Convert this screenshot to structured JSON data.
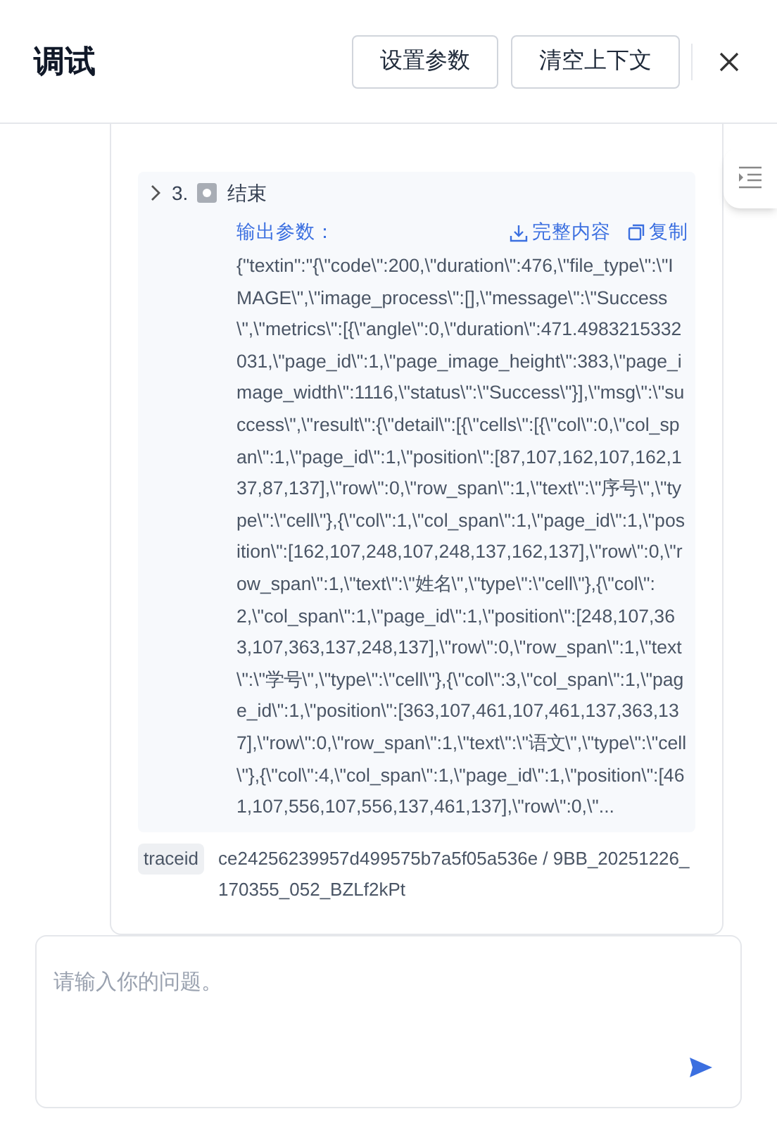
{
  "header": {
    "title": "调试",
    "buttons": [
      "设置参数",
      "清空上下文"
    ]
  },
  "step": {
    "number": "3.",
    "label": "结束"
  },
  "output": {
    "label": "输出参数：",
    "actions": [
      {
        "kind": "download",
        "label": "完整内容"
      },
      {
        "kind": "copy",
        "label": "复制"
      }
    ],
    "text": "{\"textin\":\"{\\\"code\\\":200,\\\"duration\\\":476,\\\"file_type\\\":\\\"IMAGE\\\",\\\"image_process\\\":[],\\\"message\\\":\\\"Success\\\",\\\"metrics\\\":[{\\\"angle\\\":0,\\\"duration\\\":471.4983215332031,\\\"page_id\\\":1,\\\"page_image_height\\\":383,\\\"page_image_width\\\":1116,\\\"status\\\":\\\"Success\\\"}],\\\"msg\\\":\\\"success\\\",\\\"result\\\":{\\\"detail\\\":[{\\\"cells\\\":[{\\\"col\\\":0,\\\"col_span\\\":1,\\\"page_id\\\":1,\\\"position\\\":[87,107,162,107,162,137,87,137],\\\"row\\\":0,\\\"row_span\\\":1,\\\"text\\\":\\\"序号\\\",\\\"type\\\":\\\"cell\\\"},{\\\"col\\\":1,\\\"col_span\\\":1,\\\"page_id\\\":1,\\\"position\\\":[162,107,248,107,248,137,162,137],\\\"row\\\":0,\\\"row_span\\\":1,\\\"text\\\":\\\"姓名\\\",\\\"type\\\":\\\"cell\\\"},{\\\"col\\\":2,\\\"col_span\\\":1,\\\"page_id\\\":1,\\\"position\\\":[248,107,363,107,363,137,248,137],\\\"row\\\":0,\\\"row_span\\\":1,\\\"text\\\":\\\"学号\\\",\\\"type\\\":\\\"cell\\\"},{\\\"col\\\":3,\\\"col_span\\\":1,\\\"page_id\\\":1,\\\"position\\\":[363,107,461,107,461,137,363,137],\\\"row\\\":0,\\\"row_span\\\":1,\\\"text\\\":\\\"语文\\\",\\\"type\\\":\\\"cell\\\"},{\\\"col\\\":4,\\\"col_span\\\":1,\\\"page_id\\\":1,\\\"position\\\":[461,107,556,107,556,137,461,137],\\\"row\\\":0,\\\"..."
  },
  "trace": {
    "tag": "traceid",
    "value": "ce24256239957d499575b7a5f05a536e / 9BB_20251226_170355_052_BZLf2kPt"
  },
  "input": {
    "placeholder": "请输入你的问题。"
  }
}
